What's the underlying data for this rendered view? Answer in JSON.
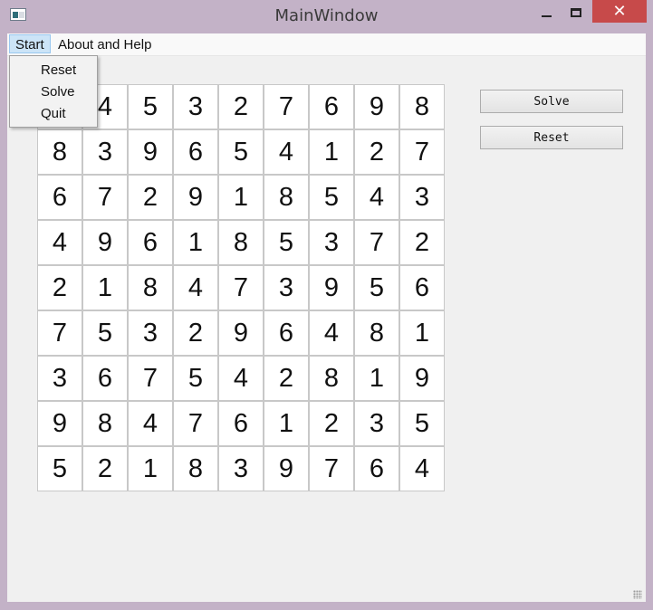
{
  "window": {
    "title": "MainWindow",
    "close_glyph": "✕"
  },
  "menubar": {
    "start_label": "Start",
    "help_label": "About and Help"
  },
  "start_menu": {
    "items": [
      "Reset",
      "Solve",
      "Quit"
    ]
  },
  "sudoku": {
    "rows": [
      [
        "",
        "4",
        "5",
        "3",
        "2",
        "7",
        "6",
        "9",
        "8"
      ],
      [
        "8",
        "3",
        "9",
        "6",
        "5",
        "4",
        "1",
        "2",
        "7"
      ],
      [
        "6",
        "7",
        "2",
        "9",
        "1",
        "8",
        "5",
        "4",
        "3"
      ],
      [
        "4",
        "9",
        "6",
        "1",
        "8",
        "5",
        "3",
        "7",
        "2"
      ],
      [
        "2",
        "1",
        "8",
        "4",
        "7",
        "3",
        "9",
        "5",
        "6"
      ],
      [
        "7",
        "5",
        "3",
        "2",
        "9",
        "6",
        "4",
        "8",
        "1"
      ],
      [
        "3",
        "6",
        "7",
        "5",
        "4",
        "2",
        "8",
        "1",
        "9"
      ],
      [
        "9",
        "8",
        "4",
        "7",
        "6",
        "1",
        "2",
        "3",
        "5"
      ],
      [
        "5",
        "2",
        "1",
        "8",
        "3",
        "9",
        "7",
        "6",
        "4"
      ]
    ]
  },
  "buttons": {
    "solve_label": "Solve",
    "reset_label": "Reset"
  },
  "colors": {
    "window_frame": "#c3b2c7",
    "close_button": "#c74a4a",
    "menu_highlight": "#cce4f7",
    "client_bg": "#f0f0f0"
  }
}
